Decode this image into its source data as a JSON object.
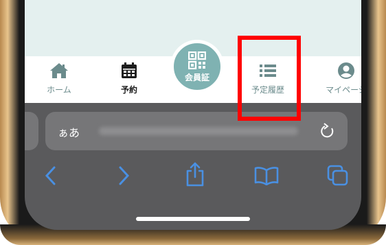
{
  "app": {
    "tabs": [
      {
        "label": "ホーム",
        "icon": "home-icon"
      },
      {
        "label": "予約",
        "icon": "calendar-icon"
      },
      {
        "label": "予定履歴",
        "icon": "list-icon"
      },
      {
        "label": "マイページ",
        "icon": "user-icon"
      }
    ],
    "card_button": {
      "label": "会員証",
      "icon": "qr-code-icon"
    },
    "highlighted_tab": "予定履歴"
  },
  "browser": {
    "text_size_label": "ぁあ",
    "url": "",
    "toolbar": [
      "back-icon",
      "forward-icon",
      "share-icon",
      "bookmarks-icon",
      "tabs-icon"
    ]
  },
  "colors": {
    "accent": "#7fb2b2",
    "tab_label": "#6b8b8c",
    "highlight": "#ff0000",
    "app_background": "#e4f0ef",
    "browser_ui": "#5a5a5c",
    "toolbar_icon": "#4a90e2"
  }
}
